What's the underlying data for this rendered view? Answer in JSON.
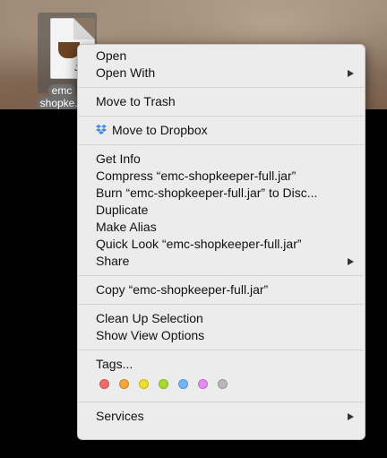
{
  "desktop": {
    "file_icon": {
      "badge": "JAR",
      "label_line1": "emc",
      "label_line2": "shopke..."
    }
  },
  "context_menu": {
    "group1": {
      "open": "Open",
      "open_with": "Open With"
    },
    "group2": {
      "move_to_trash": "Move to Trash"
    },
    "group3": {
      "move_to_dropbox": "Move to Dropbox"
    },
    "group4": {
      "get_info": "Get Info",
      "compress": "Compress “emc-shopkeeper-full.jar”",
      "burn": "Burn “emc-shopkeeper-full.jar” to Disc...",
      "duplicate": "Duplicate",
      "make_alias": "Make Alias",
      "quick_look": "Quick Look “emc-shopkeeper-full.jar”",
      "share": "Share"
    },
    "group5": {
      "copy": "Copy “emc-shopkeeper-full.jar”"
    },
    "group6": {
      "clean_up_selection": "Clean Up Selection",
      "show_view_options": "Show View Options"
    },
    "group7": {
      "tags": "Tags...",
      "tag_colors": [
        "#f06b6b",
        "#f6a73a",
        "#f2de2c",
        "#a6da32",
        "#6fb7f6",
        "#e28ef0",
        "#b8b8b8"
      ]
    },
    "group8": {
      "services": "Services"
    }
  }
}
